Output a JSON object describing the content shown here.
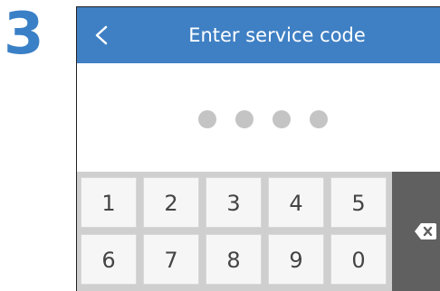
{
  "step": {
    "number": "3"
  },
  "header": {
    "title": "Enter service code",
    "back_icon": "chevron-left-icon"
  },
  "pin": {
    "length": 4,
    "entered": 0,
    "dot_color": "#c4c4c4"
  },
  "keypad": {
    "row1": [
      "1",
      "2",
      "3",
      "4",
      "5"
    ],
    "row2": [
      "6",
      "7",
      "8",
      "9",
      "0"
    ],
    "backspace_icon": "backspace-icon"
  },
  "colors": {
    "header_bg": "#3f80c4",
    "step_number": "#3a80c6",
    "backspace_bg": "#606060",
    "key_bg": "#f6f6f6"
  }
}
